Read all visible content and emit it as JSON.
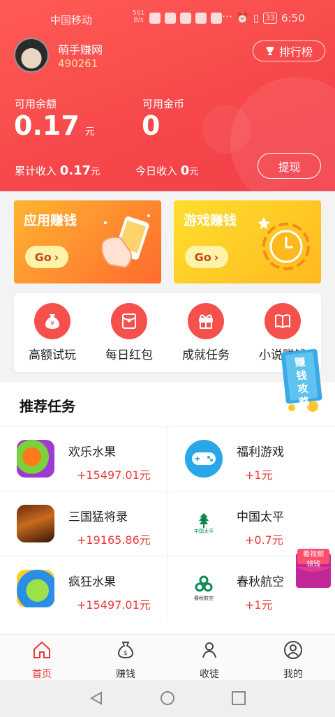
{
  "status_bar": {
    "carrier": "中国移动",
    "net_speed_value": "501",
    "net_speed_unit": "B/s",
    "battery": "33",
    "time": "6:50"
  },
  "user": {
    "name": "萌手赚网",
    "id": "490261"
  },
  "rank_button": "排行榜",
  "balance": {
    "available_label": "可用余额",
    "available_value": "0.17",
    "available_unit": "元",
    "coins_label": "可用金币",
    "coins_value": "0"
  },
  "earnings": {
    "total_label": "累计收入",
    "total_value": "0.17",
    "total_unit": "元",
    "today_label": "今日收入",
    "today_value": "0",
    "today_unit": "元"
  },
  "withdraw_button": "提现",
  "cards": [
    {
      "title": "应用赚钱",
      "go": "Go"
    },
    {
      "title": "游戏赚钱",
      "go": "Go"
    }
  ],
  "quick_actions": [
    {
      "label": "高额试玩",
      "icon": "money-bag-icon"
    },
    {
      "label": "每日红包",
      "icon": "red-envelope-icon"
    },
    {
      "label": "成就任务",
      "icon": "gift-icon"
    },
    {
      "label": "小说赚钱",
      "icon": "book-icon"
    }
  ],
  "float_guide": "赚钱攻略",
  "float_video_line1": "看视频",
  "float_video_line2": "领钱",
  "section_title": "推荐任务",
  "tasks": [
    {
      "name": "欢乐水果",
      "reward": "+15497.01元",
      "icon": "fruit-game-icon"
    },
    {
      "name": "福利游戏",
      "reward": "+1元",
      "icon": "gamepad-icon"
    },
    {
      "name": "三国猛将录",
      "reward": "+19165.86元",
      "icon": "warrior-game-icon"
    },
    {
      "name": "中国太平",
      "reward": "+0.7元",
      "icon": "china-taiping-logo"
    },
    {
      "name": "疯狂水果",
      "reward": "+15497.01元",
      "icon": "crazy-fruit-icon"
    },
    {
      "name": "春秋航空",
      "reward": "+1元",
      "icon": "spring-airlines-logo"
    }
  ],
  "china_taiping_logo_text": "中国太平",
  "spring_airlines_logo_text": "春秋航空",
  "bottom_nav": [
    {
      "label": "首页",
      "active": true
    },
    {
      "label": "赚钱",
      "active": false
    },
    {
      "label": "收徒",
      "active": false
    },
    {
      "label": "我的",
      "active": false
    }
  ],
  "colors": {
    "brand_red": "#f6474a",
    "reward_red": "#e8393a",
    "card_app": "#ff8a2e",
    "card_game": "#ffc61e"
  }
}
